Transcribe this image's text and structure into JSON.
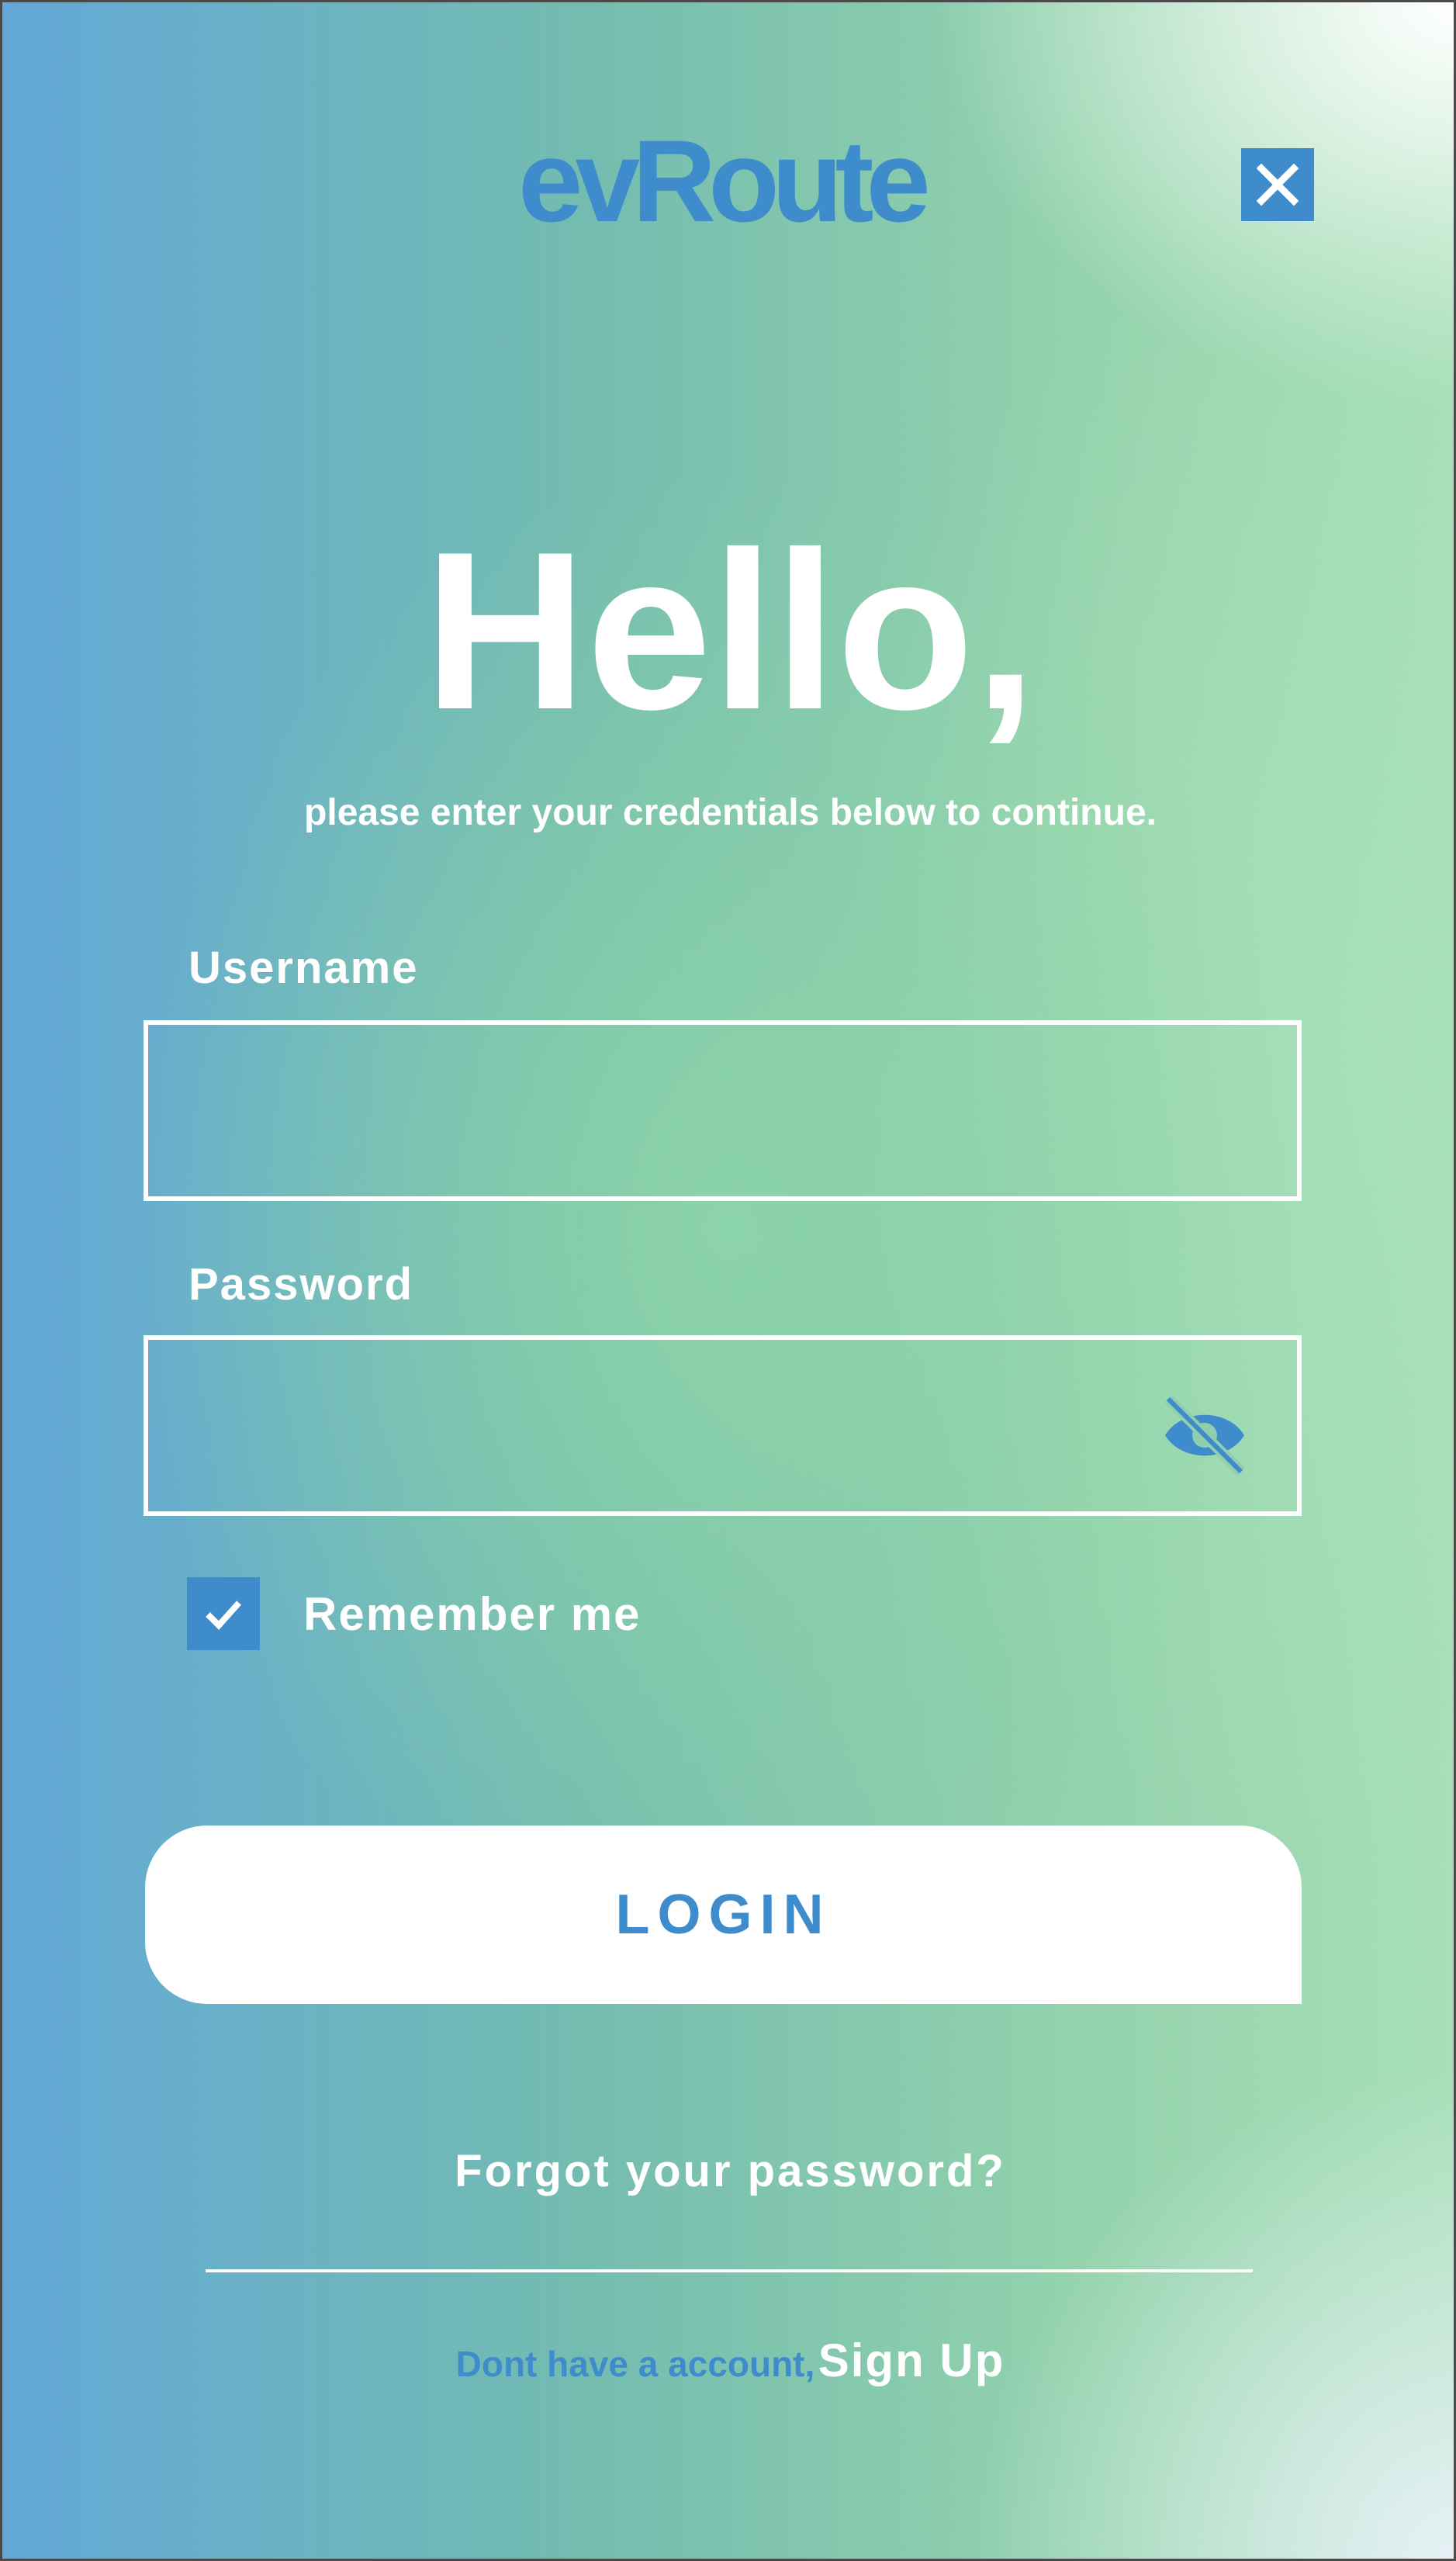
{
  "brand": {
    "logo_text": "evRoute",
    "color": "#3f8ccc"
  },
  "header": {
    "close_icon": "close-icon"
  },
  "greeting": {
    "title": "Hello,",
    "subtitle": "please enter your credentials below to continue."
  },
  "form": {
    "username_label": "Username",
    "username_value": "",
    "password_label": "Password",
    "password_value": "",
    "password_toggle_icon": "eye-off-icon",
    "remember_label": "Remember me",
    "remember_checked": true,
    "login_label": "LOGIN"
  },
  "footer": {
    "forgot_label": "Forgot your password?",
    "no_account_text": "Dont have a account,",
    "signup_label": "Sign Up"
  },
  "colors": {
    "accent": "#3f8ccc",
    "text": "#ffffff"
  }
}
